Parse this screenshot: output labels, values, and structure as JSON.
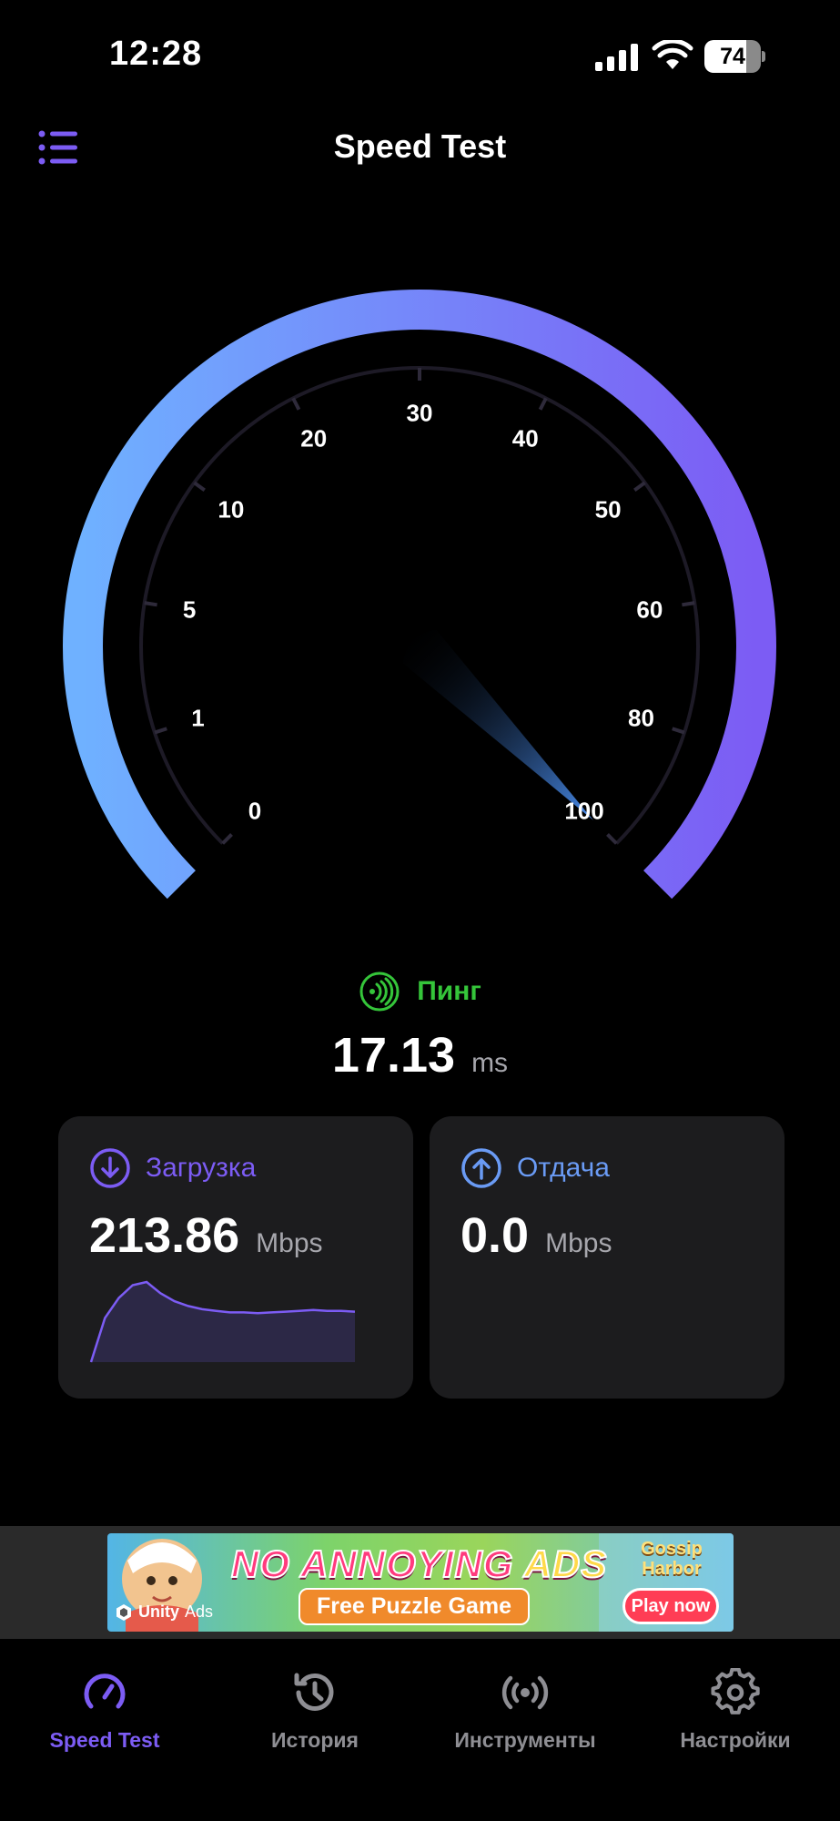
{
  "status_bar": {
    "time": "12:28",
    "battery_level": "74",
    "battery_fraction": 0.74,
    "icons": [
      "cellular-signal-icon",
      "wifi-icon",
      "battery-icon"
    ]
  },
  "header": {
    "title": "Speed Test",
    "menu_icon": "list-menu-icon"
  },
  "gauge": {
    "scale_labels": [
      "0",
      "1",
      "5",
      "10",
      "20",
      "30",
      "40",
      "50",
      "60",
      "80",
      "100"
    ],
    "needle_at": "100",
    "gradient_start": "#6fb1ff",
    "gradient_end": "#7c5cf4"
  },
  "ping": {
    "label": "Пинг",
    "value": "17.13",
    "unit": "ms",
    "icon": "ping-signal-icon",
    "color": "#35c53a"
  },
  "download": {
    "label": "Загрузка",
    "value": "213.86",
    "unit": "Mbps",
    "icon": "download-arrow-icon",
    "color": "#7c5cf4",
    "sparkline": [
      0,
      55,
      80,
      96,
      100,
      86,
      76,
      70,
      66,
      64,
      62,
      62,
      61,
      62,
      63,
      64,
      65,
      64,
      64,
      63
    ]
  },
  "upload": {
    "label": "Отдача",
    "value": "0.0",
    "unit": "Mbps",
    "icon": "upload-arrow-icon",
    "color": "#6a9bf5"
  },
  "ad": {
    "headline_part1": "NO ANNOYING",
    "headline_part2": "ADS",
    "subtitle": "Free Puzzle Game",
    "brand_line1": "Gossip",
    "brand_line2": "Harbor",
    "cta": "Play now",
    "provider": "Unity",
    "provider_suffix": "Ads"
  },
  "tab_bar": {
    "active_color": "#7c5cf4",
    "inactive_color": "#8e8e93",
    "tabs": [
      {
        "label": "Speed Test",
        "icon": "speedometer-icon",
        "active": true
      },
      {
        "label": "История",
        "icon": "history-clock-icon",
        "active": false
      },
      {
        "label": "Инструменты",
        "icon": "broadcast-tools-icon",
        "active": false
      },
      {
        "label": "Настройки",
        "icon": "gear-icon",
        "active": false
      }
    ]
  }
}
